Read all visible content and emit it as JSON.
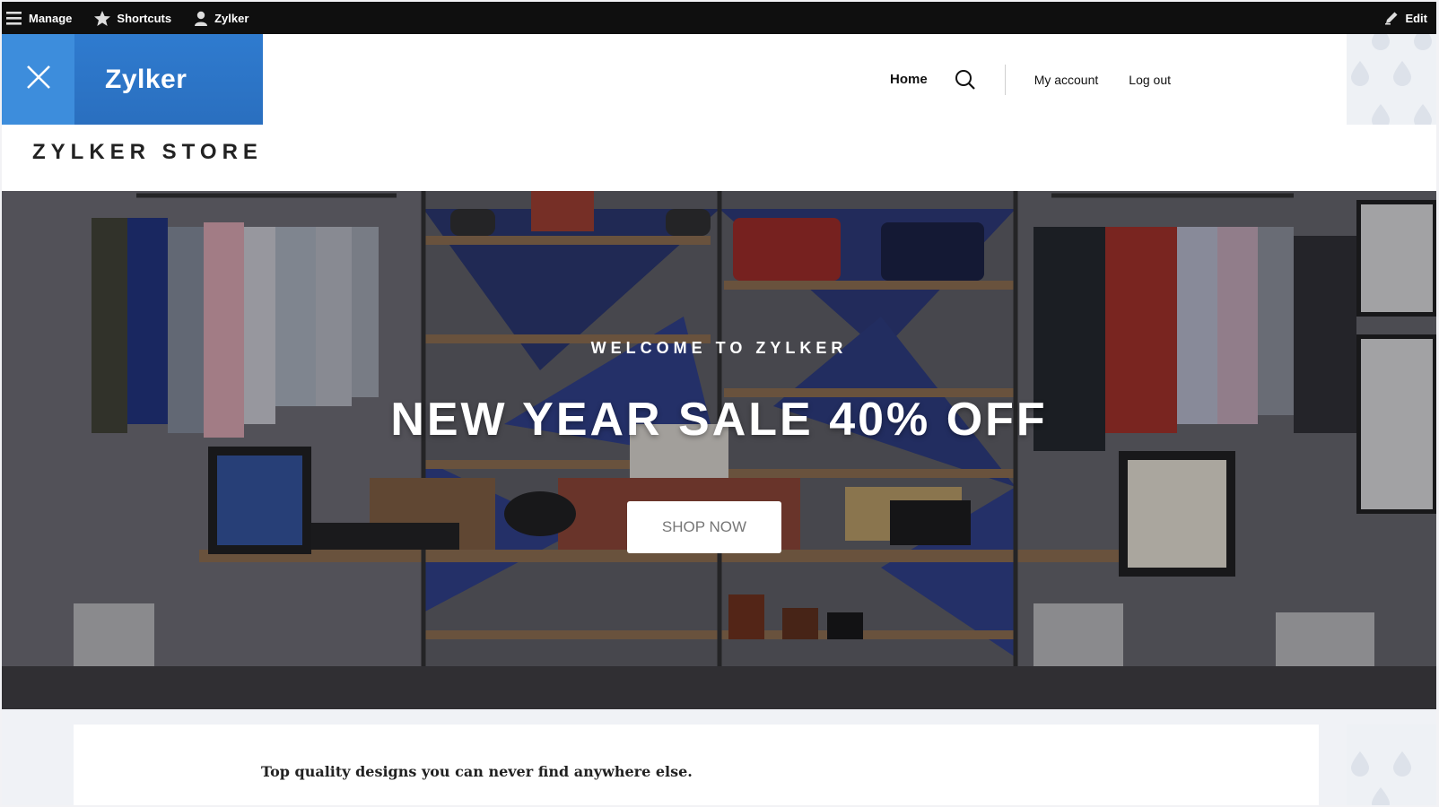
{
  "toolbar": {
    "manage": "Manage",
    "shortcuts": "Shortcuts",
    "user": "Zylker",
    "edit": "Edit"
  },
  "header": {
    "brand": "Zylker",
    "store_name": "ZYLKER STORE",
    "nav": {
      "home": "Home",
      "my_account": "My account",
      "log_out": "Log out"
    }
  },
  "hero": {
    "subtitle": "WELCOME TO ZYLKER",
    "title": "NEW YEAR SALE 40% OFF",
    "button": "SHOP NOW"
  },
  "content": {
    "tagline": "Top quality designs you can never find anywhere else."
  },
  "colors": {
    "toolbar": "#0f0f0f",
    "brand_blue": "#2f7bcf",
    "close_blue": "#3d8ddc"
  }
}
